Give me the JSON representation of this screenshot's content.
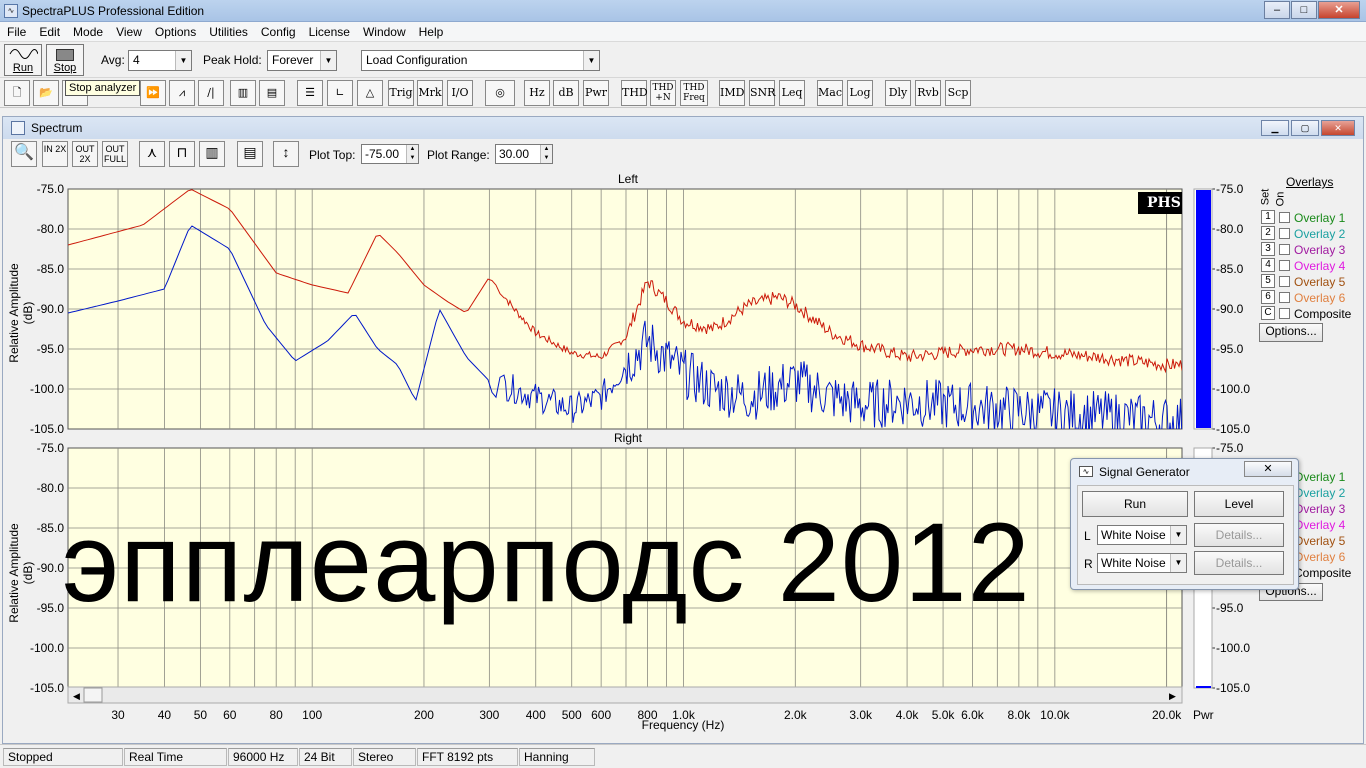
{
  "window": {
    "title": "SpectraPLUS Professional Edition",
    "min": "–",
    "max": "□",
    "close": "✕"
  },
  "menu": [
    "File",
    "Edit",
    "Mode",
    "View",
    "Options",
    "Utilities",
    "Config",
    "License",
    "Window",
    "Help"
  ],
  "toolbar": {
    "run_label": "Run",
    "stop_label": "Stop",
    "avg_label": "Avg:",
    "avg_value": "4",
    "peak_label": "Peak Hold:",
    "peak_value": "Forever",
    "config_value": "Load Configuration",
    "tooltip": "Stop analyzer",
    "buttons": [
      "Trig",
      "Mrk",
      "I/O",
      "Hz",
      "dB",
      "Pwr",
      "THD",
      "THD +N",
      "THD Freq",
      "IMD",
      "SNR",
      "Leq",
      "Mac",
      "Log",
      "Dly",
      "Rvb",
      "Scp"
    ]
  },
  "spectrum": {
    "title": "Spectrum",
    "plot_top_label": "Plot Top:",
    "plot_top_value": "-75.00",
    "plot_range_label": "Plot Range:",
    "plot_range_value": "30.00",
    "zoom_buttons": [
      "IN 2X",
      "OUT 2X",
      "OUT FULL"
    ],
    "logo": "PHS",
    "pwr_label": "Pwr",
    "left_title": "Left",
    "right_title": "Right",
    "ylabel": "Relative Amplitude (dB)",
    "xlabel": "Frequency (Hz)",
    "y_ticks": [
      "-75.0",
      "-80.0",
      "-85.0",
      "-90.0",
      "-95.0",
      "-100.0",
      "-105.0"
    ],
    "x_ticks": [
      "30",
      "40",
      "50",
      "60",
      "80",
      "100",
      "200",
      "300",
      "400",
      "500",
      "600",
      "800",
      "1.0k",
      "2.0k",
      "3.0k",
      "4.0k",
      "5.0k",
      "6.0k",
      "8.0k",
      "10.0k",
      "20.0k"
    ],
    "overlays": {
      "header": "Overlays",
      "set_label": "Set",
      "on_label": "On",
      "items": [
        {
          "set": "1",
          "label": "Overlay 1",
          "color": "#1a8a1a"
        },
        {
          "set": "2",
          "label": "Overlay 2",
          "color": "#1aa0a0"
        },
        {
          "set": "3",
          "label": "Overlay 3",
          "color": "#a01aa0"
        },
        {
          "set": "4",
          "label": "Overlay 4",
          "color": "#e01ae0"
        },
        {
          "set": "5",
          "label": "Overlay 5",
          "color": "#a05010"
        },
        {
          "set": "6",
          "label": "Overlay 6",
          "color": "#e08040"
        },
        {
          "set": "C",
          "label": "Composite",
          "color": "#000000"
        }
      ],
      "options_button": "Options...",
      "right_items": [
        "Overlay 1",
        "Overlay 2",
        "Overlay 3",
        "Overlay 4",
        "Overlay 5",
        "Overlay 6",
        "Composite"
      ]
    }
  },
  "signal_generator": {
    "title": "Signal Generator",
    "run": "Run",
    "level": "Level",
    "l_label": "L",
    "r_label": "R",
    "l_value": "White Noise",
    "r_value": "White Noise",
    "details": "Details..."
  },
  "status": [
    "Stopped",
    "Real Time",
    "96000 Hz",
    "24 Bit",
    "Stereo",
    "FFT 8192 pts",
    "Hanning"
  ],
  "watermark": "эпплеарподс 2012",
  "colors": {
    "plot_bg": "#ffffe1",
    "left_trace": "#cc1a0a",
    "right_trace": "#0018c8",
    "pwr_bar": "#0000ff"
  },
  "chart_data": [
    {
      "type": "line",
      "title": "Left",
      "xlabel": "Frequency (Hz)",
      "ylabel": "Relative Amplitude (dB)",
      "x_scale": "log",
      "xlim": [
        22,
        22000
      ],
      "ylim": [
        -105,
        -75
      ],
      "grid": true,
      "series": [
        {
          "color": "#cc1a0a",
          "x": [
            22,
            35,
            47,
            60,
            80,
            100,
            125,
            150,
            170,
            200,
            230,
            260,
            300,
            350,
            400,
            500,
            600,
            700,
            800,
            900,
            1000,
            1200,
            1500,
            1800,
            2000,
            2500,
            3000,
            4000,
            5000,
            6000,
            8000,
            10000,
            13000,
            16000,
            20000
          ],
          "y": [
            -82,
            -79.5,
            -75,
            -77.5,
            -85.5,
            -87,
            -88,
            -80.5,
            -83,
            -87,
            -89,
            -90.5,
            -86,
            -90,
            -93,
            -95.5,
            -96,
            -93.5,
            -86.5,
            -89,
            -91.5,
            -92.5,
            -89.5,
            -88.5,
            -89.5,
            -93,
            -94.5,
            -96,
            -95.5,
            -95,
            -95,
            -95.5,
            -96,
            -96.5,
            -97
          ]
        },
        {
          "color": "#0018c8",
          "x": [
            22,
            30,
            40,
            47,
            60,
            75,
            90,
            110,
            130,
            150,
            170,
            190,
            220,
            260,
            300,
            350,
            400,
            500,
            600,
            700,
            800,
            1000,
            1200,
            1500,
            2000,
            2500,
            3000,
            4000,
            5000,
            7000,
            10000,
            15000,
            20000
          ],
          "y": [
            -90.5,
            -89,
            -87.5,
            -79.5,
            -82.5,
            -92,
            -96.5,
            -94,
            -90.5,
            -95,
            -97,
            -101.5,
            -90,
            -96,
            -99,
            -100,
            -101,
            -102.5,
            -101,
            -97,
            -94,
            -98,
            -100,
            -101,
            -99,
            -101,
            -102,
            -101.5,
            -102,
            -102.5,
            -103,
            -103.5,
            -104
          ]
        }
      ]
    },
    {
      "type": "line",
      "title": "Right",
      "xlabel": "Frequency (Hz)",
      "ylabel": "Relative Amplitude (dB)",
      "x_scale": "log",
      "xlim": [
        22,
        22000
      ],
      "ylim": [
        -105,
        -75
      ],
      "grid": true,
      "series": []
    }
  ]
}
